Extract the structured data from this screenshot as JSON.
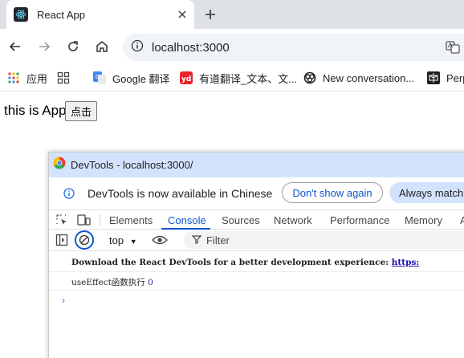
{
  "browser": {
    "tab_title": "React App",
    "url": "localhost:3000"
  },
  "bookmarks": {
    "apps_label": "应用",
    "items": [
      {
        "label": "Google 翻译"
      },
      {
        "label": "有道翻译_文本、文..."
      },
      {
        "label": "New conversation..."
      },
      {
        "label": "Perp"
      }
    ]
  },
  "page": {
    "text": "this is App",
    "button_label": "点击"
  },
  "devtools": {
    "window_title": "DevTools - localhost:3000/",
    "infobar": {
      "message": "DevTools is now available in Chinese",
      "dismiss_label": "Don't show again",
      "always_label": "Always match"
    },
    "tabs": [
      "Elements",
      "Console",
      "Sources",
      "Network",
      "Performance",
      "Memory",
      "A"
    ],
    "active_tab": "Console",
    "console": {
      "context": "top",
      "filter_placeholder": "Filter",
      "messages": [
        {
          "text": "Download the React DevTools for a better development experience: ",
          "link": "https:"
        },
        {
          "text": "useEffect函数执行 ",
          "value": "0"
        }
      ],
      "prompt": "›"
    }
  },
  "colors": {
    "accent": "#0b57d0",
    "titlebar": "#d3e3fd",
    "tabstrip": "#dee1e6"
  }
}
